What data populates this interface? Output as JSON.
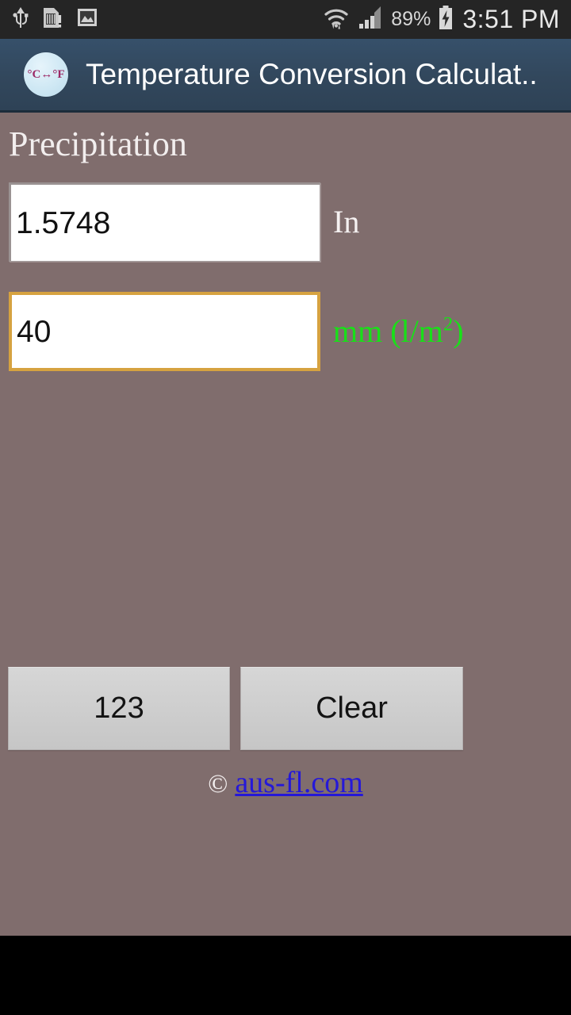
{
  "status_bar": {
    "left_icons": [
      {
        "name": "usb-icon",
        "label": "USB"
      },
      {
        "name": "sd-card-warning-icon",
        "label": "SD card warning"
      },
      {
        "name": "image-icon",
        "label": "Screenshot captured"
      }
    ],
    "right_icons": [
      {
        "name": "wifi-icon",
        "label": "Wi-Fi"
      },
      {
        "name": "cellular-signal-icon",
        "label": "Signal"
      },
      {
        "name": "battery-charging-icon",
        "label": "Battery charging"
      }
    ],
    "battery_percent": "89%",
    "clock": "3:51 PM"
  },
  "title_bar": {
    "app_icon_text": "°C↔°F",
    "title": "Temperature Conversion Calculat.."
  },
  "main": {
    "section_title": "Precipitation",
    "fields": [
      {
        "name": "inches-field",
        "value": "1.5748",
        "placeholder": "",
        "unit_label": "In",
        "unit_color": "#f5f1f1",
        "focused": false
      },
      {
        "name": "millimeters-field",
        "value": "40",
        "placeholder": "",
        "unit_label_main": "mm (l/m",
        "unit_label_sup": "2",
        "unit_label_tail": ")",
        "unit_color": "#18e118",
        "focused": true
      }
    ],
    "buttons": [
      {
        "name": "numeric-keypad-button",
        "label": "123"
      },
      {
        "name": "clear-button",
        "label": "Clear"
      }
    ],
    "footer": {
      "copyright_symbol": "©",
      "link_text": "aus-fl.com"
    }
  },
  "colors": {
    "background": "#806d6d",
    "title_bar": "#32475c",
    "status_bar": "#252525",
    "focus_border": "#d6a240",
    "link": "#2518d8",
    "unit_green": "#18e118"
  }
}
